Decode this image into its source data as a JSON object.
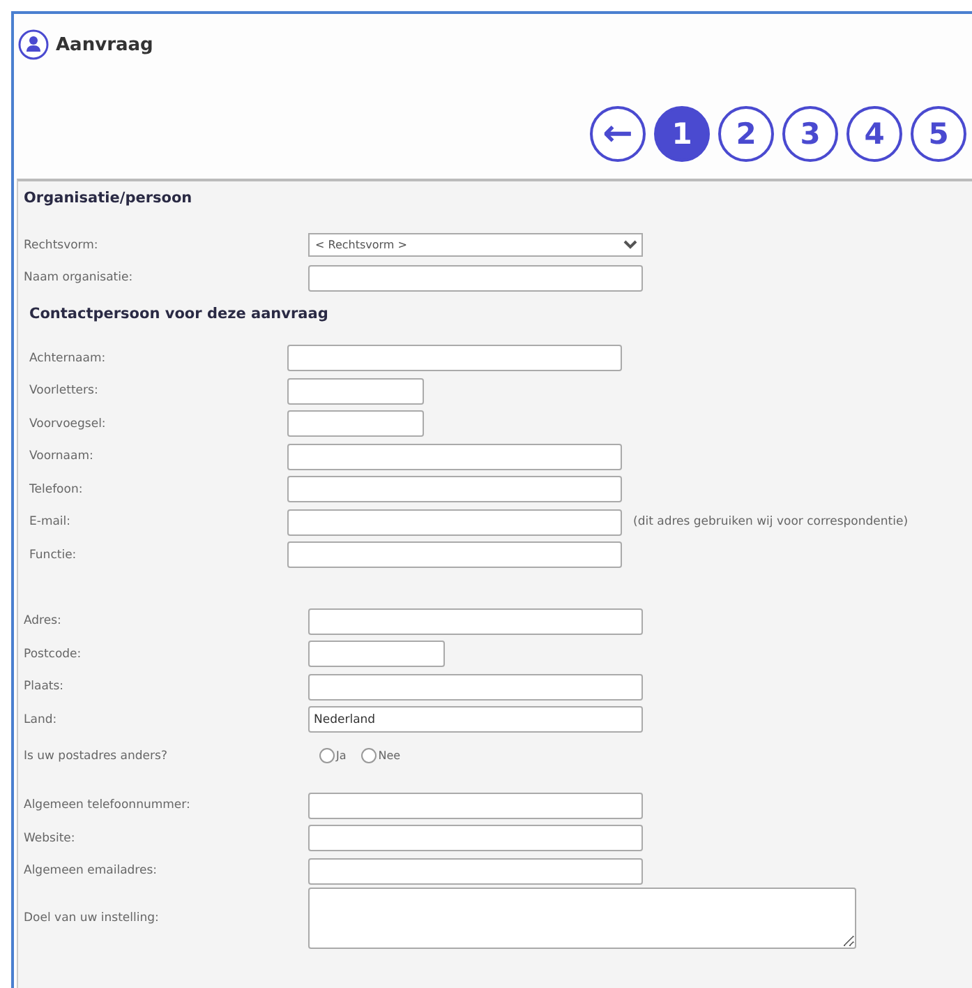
{
  "window": {
    "title": "Aanvraag"
  },
  "steps": [
    {
      "label": "←",
      "kind": "back",
      "selected": false
    },
    {
      "label": "1",
      "kind": "step",
      "selected": true
    },
    {
      "label": "2",
      "kind": "step",
      "selected": false
    },
    {
      "label": "3",
      "kind": "step",
      "selected": false
    },
    {
      "label": "4",
      "kind": "step",
      "selected": false
    },
    {
      "label": "5",
      "kind": "step",
      "selected": false
    }
  ],
  "sections": [
    {
      "heading": "Organisatie/persoon",
      "fields": [
        {
          "label": "Rechtsvorm:",
          "kind": "select",
          "value": "< Rechtsvorm >"
        },
        {
          "label": "Naam organisatie:",
          "kind": "text"
        }
      ]
    },
    {
      "heading": "Contactpersoon voor deze aanvraag",
      "fields": [
        {
          "label": "Achternaam:",
          "kind": "text"
        },
        {
          "label": "Voorletters:",
          "kind": "short"
        },
        {
          "label": "Voorvoegsel:",
          "kind": "short"
        },
        {
          "label": "Voornaam:",
          "kind": "text"
        },
        {
          "label": "Telefoon:",
          "kind": "text"
        },
        {
          "label": "E-mail:",
          "kind": "text",
          "note": "(dit adres gebruiken wij voor correspondentie)"
        },
        {
          "label": "Functie:",
          "kind": "text"
        }
      ]
    },
    {
      "fields": [
        {
          "label": "Adres:",
          "kind": "text"
        },
        {
          "label": "Postcode:",
          "kind": "short"
        },
        {
          "label": "Plaats:",
          "kind": "text"
        },
        {
          "label": "Land:",
          "kind": "text",
          "value": "Nederland"
        },
        {
          "label": "Is uw postadres anders?",
          "kind": "radios",
          "options": [
            {
              "label": "Ja",
              "selected": false
            },
            {
              "label": "Nee",
              "selected": false
            }
          ]
        },
        {
          "label": "Algemeen telefoonnummer:",
          "kind": "text"
        },
        {
          "label": "Website:",
          "kind": "text"
        },
        {
          "label": "Algemeen emailadres:",
          "kind": "text"
        },
        {
          "label": "Doel van uw instelling:",
          "kind": "textarea"
        }
      ]
    }
  ]
}
